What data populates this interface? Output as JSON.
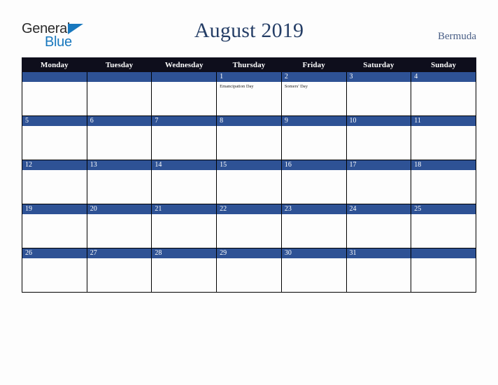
{
  "brand": {
    "name_part1": "General",
    "name_part2": "Blue",
    "accent_color": "#1878be",
    "text_color": "#2b2b2b"
  },
  "header": {
    "title": "August 2019",
    "region": "Bermuda",
    "title_color": "#253e66",
    "region_color": "#4a5f86"
  },
  "calendar": {
    "month": "August",
    "year": "2019",
    "header_bg": "#0e0e1c",
    "daybar_bg": "#2e5295",
    "cell_bg": "#fdfdfd",
    "weekday_headers": [
      "Monday",
      "Tuesday",
      "Wednesday",
      "Thursday",
      "Friday",
      "Saturday",
      "Sunday"
    ],
    "weeks": [
      [
        {
          "day": "",
          "events": []
        },
        {
          "day": "",
          "events": []
        },
        {
          "day": "",
          "events": []
        },
        {
          "day": "1",
          "events": [
            "Emancipation Day"
          ]
        },
        {
          "day": "2",
          "events": [
            "Somers' Day"
          ]
        },
        {
          "day": "3",
          "events": []
        },
        {
          "day": "4",
          "events": []
        }
      ],
      [
        {
          "day": "5",
          "events": []
        },
        {
          "day": "6",
          "events": []
        },
        {
          "day": "7",
          "events": []
        },
        {
          "day": "8",
          "events": []
        },
        {
          "day": "9",
          "events": []
        },
        {
          "day": "10",
          "events": []
        },
        {
          "day": "11",
          "events": []
        }
      ],
      [
        {
          "day": "12",
          "events": []
        },
        {
          "day": "13",
          "events": []
        },
        {
          "day": "14",
          "events": []
        },
        {
          "day": "15",
          "events": []
        },
        {
          "day": "16",
          "events": []
        },
        {
          "day": "17",
          "events": []
        },
        {
          "day": "18",
          "events": []
        }
      ],
      [
        {
          "day": "19",
          "events": []
        },
        {
          "day": "20",
          "events": []
        },
        {
          "day": "21",
          "events": []
        },
        {
          "day": "22",
          "events": []
        },
        {
          "day": "23",
          "events": []
        },
        {
          "day": "24",
          "events": []
        },
        {
          "day": "25",
          "events": []
        }
      ],
      [
        {
          "day": "26",
          "events": []
        },
        {
          "day": "27",
          "events": []
        },
        {
          "day": "28",
          "events": []
        },
        {
          "day": "29",
          "events": []
        },
        {
          "day": "30",
          "events": []
        },
        {
          "day": "31",
          "events": []
        },
        {
          "day": "",
          "events": []
        }
      ]
    ]
  }
}
